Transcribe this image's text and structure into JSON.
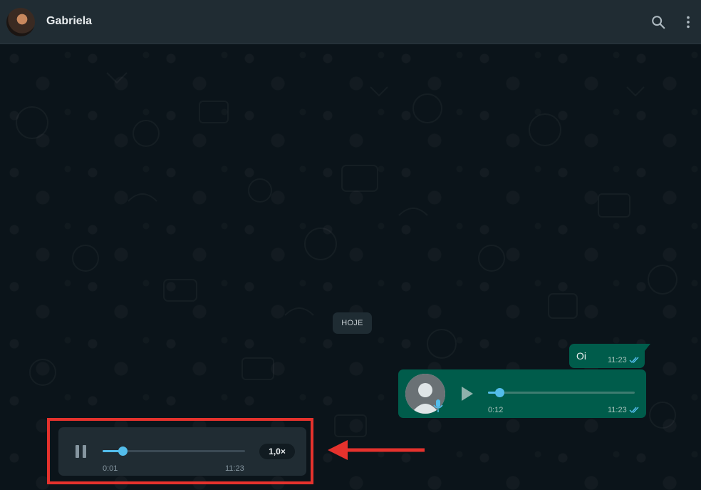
{
  "header": {
    "contact_name": "Gabriela",
    "icons": [
      "avatar",
      "search-icon",
      "menu-icon"
    ]
  },
  "chat": {
    "date_badge": "HOJE",
    "messages": [
      {
        "type": "text",
        "direction": "outgoing",
        "text": "Oi",
        "time": "11:23",
        "status": "read"
      },
      {
        "type": "voice",
        "direction": "outgoing",
        "duration": "0:12",
        "time": "11:23",
        "status": "read",
        "progress": 0.08
      }
    ]
  },
  "player": {
    "elapsed": "0:01",
    "time": "11:23",
    "speed": "1,0×",
    "progress": 0.14,
    "state": "playing"
  },
  "colors": {
    "header_bg": "#202c33",
    "chat_bg": "#0b141a",
    "outgoing_bubble": "#005c4b",
    "incoming_bubble": "#202c33",
    "read_ticks": "#53bdeb",
    "progress_accent": "#53bdeb",
    "highlight": "#e5322d"
  }
}
